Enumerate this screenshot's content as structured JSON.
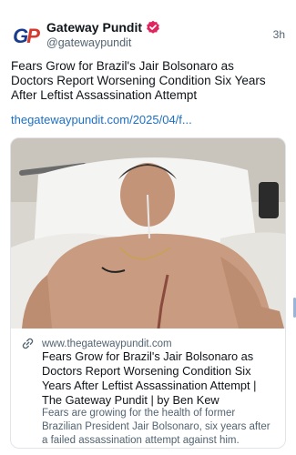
{
  "author": {
    "name": "Gateway Pundit",
    "handle": "@gatewaypundit",
    "logo_text": "GP"
  },
  "post": {
    "time": "3h",
    "text": "Fears Grow for Brazil's Jair Bolsonaro as Doctors Report Worsening Condition Six Years After Leftist Assassination Attempt",
    "link": "thegatewaypundit.com/2025/04/f..."
  },
  "card": {
    "domain": "www.thegatewaypundit.com",
    "title": "Fears Grow for Brazil's Jair Bolsonaro as Doctors Report Worsening Condition Six Years After Leftist Assassination Attempt | The Gateway Pundit | by Ben Kew",
    "description": "Fears are growing for the health of former Brazilian President Jair Bolsonaro, six years after a failed assassination attempt against him.",
    "image_icon": "photo-hospital-bed"
  },
  "colors": {
    "link": "#1d6fc4",
    "verified": "#e0245e",
    "secondary": "#536471"
  }
}
